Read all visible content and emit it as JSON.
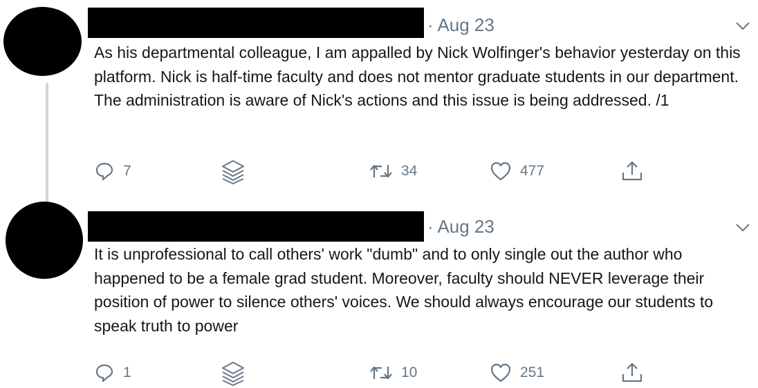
{
  "tweets": [
    {
      "date": "· Aug 23",
      "text": "As his departmental colleague, I am appalled by Nick Wolfinger's behavior yesterday on this platform. Nick is half-time faculty and does not mentor graduate students in our department. The administration is aware of Nick's actions and this issue is being addressed. /1",
      "replies": "7",
      "retweets": "34",
      "likes": "477"
    },
    {
      "date": "· Aug 23",
      "text": "It is unprofessional to call others' work \"dumb\" and to only single out the author who happened to be a female grad student.  Moreover, faculty should NEVER leverage their position of power to silence others' voices. We should always encourage our students to speak truth to power",
      "replies": "1",
      "retweets": "10",
      "likes": "251"
    }
  ],
  "icons": {
    "reply": "reply-icon",
    "stack": "stack-icon",
    "retweet": "retweet-icon",
    "like": "like-icon",
    "share": "share-icon",
    "more": "chevron-down-icon"
  },
  "colors": {
    "text": "#14171a",
    "muted": "#657786",
    "thread_line": "#ccd6dd",
    "redaction": "#000000"
  }
}
